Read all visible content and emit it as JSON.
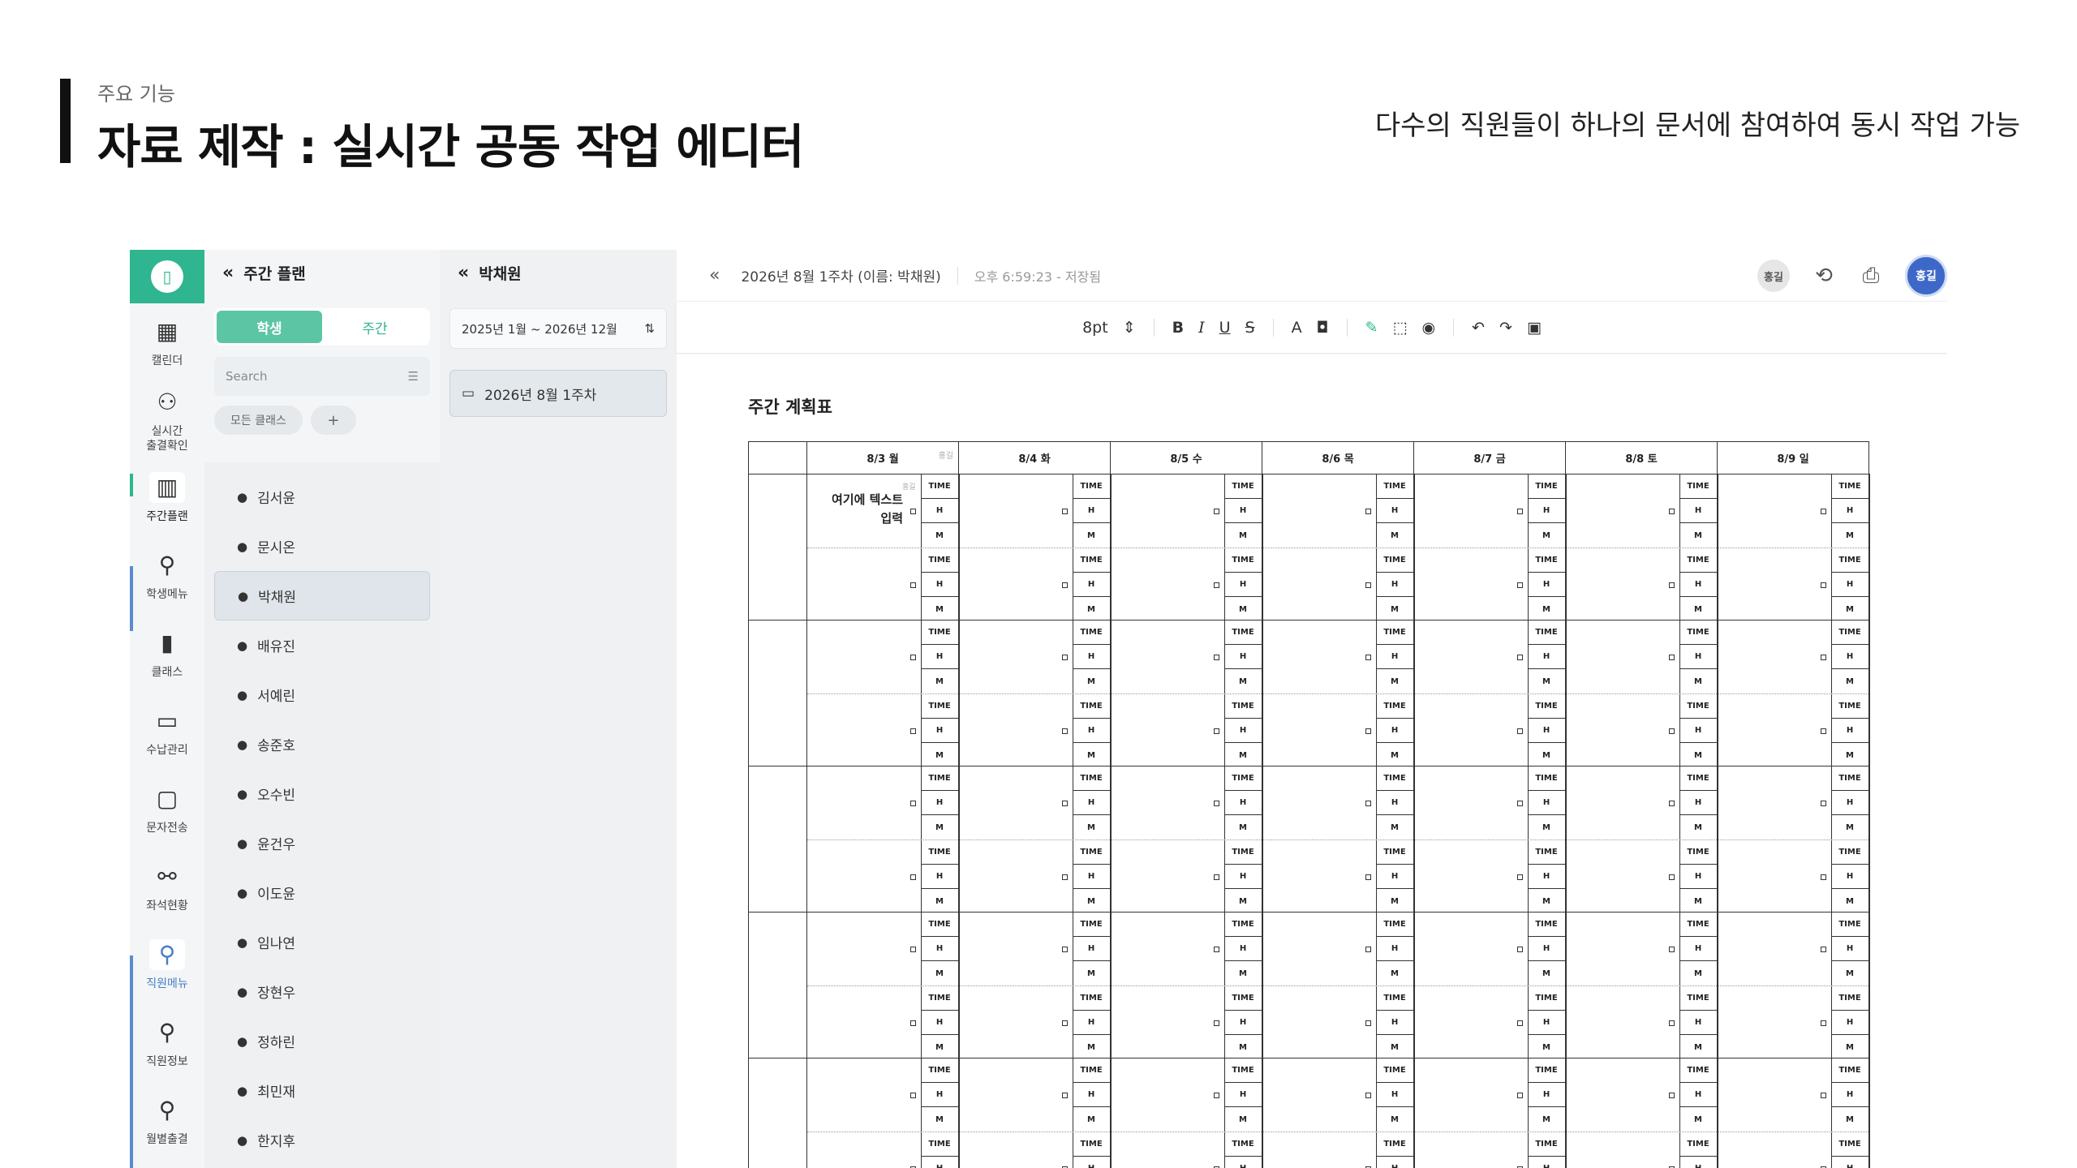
{
  "slide": {
    "subtitle": "주요 기능",
    "title": "자료 제작 : 실시간 공동 작업 에디터",
    "description": "다수의 직원들이 하나의 문서에 참여하여 동시 작업 가능"
  },
  "rail": {
    "items": [
      {
        "label": "캘린더",
        "icon": "calendar-icon"
      },
      {
        "label": "실시간\n출결확인",
        "icon": "attendance-icon"
      },
      {
        "label": "주간플랜",
        "icon": "weekly-plan-icon"
      },
      {
        "label": "학생메뉴",
        "icon": "student-menu-icon"
      },
      {
        "label": "클래스",
        "icon": "class-icon"
      },
      {
        "label": "수납관리",
        "icon": "payment-icon"
      },
      {
        "label": "문자전송",
        "icon": "message-icon"
      },
      {
        "label": "좌석현황",
        "icon": "seat-icon"
      },
      {
        "label": "직원메뉴",
        "icon": "staff-menu-icon"
      },
      {
        "label": "직원정보",
        "icon": "staff-info-icon"
      },
      {
        "label": "월별출결",
        "icon": "monthly-attendance-icon"
      }
    ]
  },
  "panel1": {
    "title": "주간 플랜",
    "tabs": [
      "학생",
      "주간"
    ],
    "search_placeholder": "Search",
    "chips": [
      "모든 클래스",
      "+"
    ],
    "students": [
      "김서윤",
      "문시온",
      "박채원",
      "배유진",
      "서예린",
      "송준호",
      "오수빈",
      "윤건우",
      "이도윤",
      "임나연",
      "장현우",
      "정하린",
      "최민재",
      "한지후"
    ]
  },
  "panel2": {
    "title": "박채원",
    "range": "2025년 1월 ~ 2026년 12월",
    "week": "2026년 8월 1주차"
  },
  "editor": {
    "doc_name": "2026년 8월 1주차 (이름: 박채원)",
    "saved": "오후 6:59:23 - 저장됨",
    "avatar_small": "홍길",
    "avatar_big": "홍길",
    "font_size": "8pt",
    "doc_title": "주간 계획표",
    "days": [
      "8/3 월",
      "8/4 화",
      "8/5 수",
      "8/6 목",
      "8/7 금",
      "8/8 토",
      "8/9 일"
    ],
    "header_user_tag": "홍길",
    "cell_user_tag": "홍길",
    "note_text": "여기에 텍스트 입력",
    "cell_labels": [
      "TIME",
      "H",
      "M"
    ]
  },
  "colors": {
    "brand": "#2fb58f",
    "avatar": "#3e68c8",
    "staff_accent": "#4a7ec4"
  }
}
